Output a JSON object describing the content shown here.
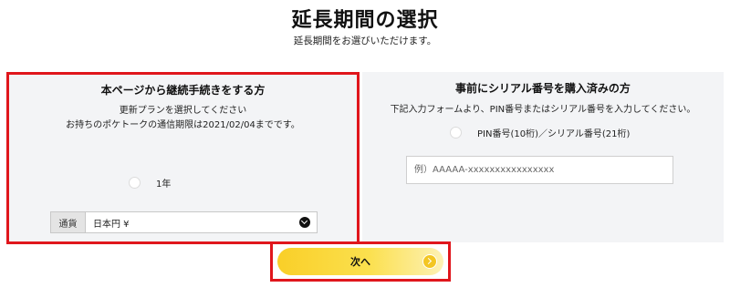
{
  "header": {
    "title": "延長期間の選択",
    "subtitle": "延長期間をお選びいただけます。"
  },
  "left_panel": {
    "heading": "本ページから継続手続きをする方",
    "line1": "更新プランを選択してください",
    "line2": "お持ちのポケトークの通信期限は2021/02/04までです。",
    "plan_option": "1年",
    "currency_label": "通貨",
    "currency_value": "日本円 ¥"
  },
  "right_panel": {
    "heading": "事前にシリアル番号を購入済みの方",
    "instruction": "下記入力フォームより、PIN番号またはシリアル番号を入力してください。",
    "radio_label": "PIN番号(10桁)／シリアル番号(21桁)",
    "input_placeholder": "例）AAAAA-xxxxxxxxxxxxxxxx"
  },
  "footer": {
    "next_label": "次へ"
  },
  "colors": {
    "highlight_border": "#e0161c",
    "button_yellow": "#f9cf28",
    "panel_bg": "#f3f4f6"
  }
}
